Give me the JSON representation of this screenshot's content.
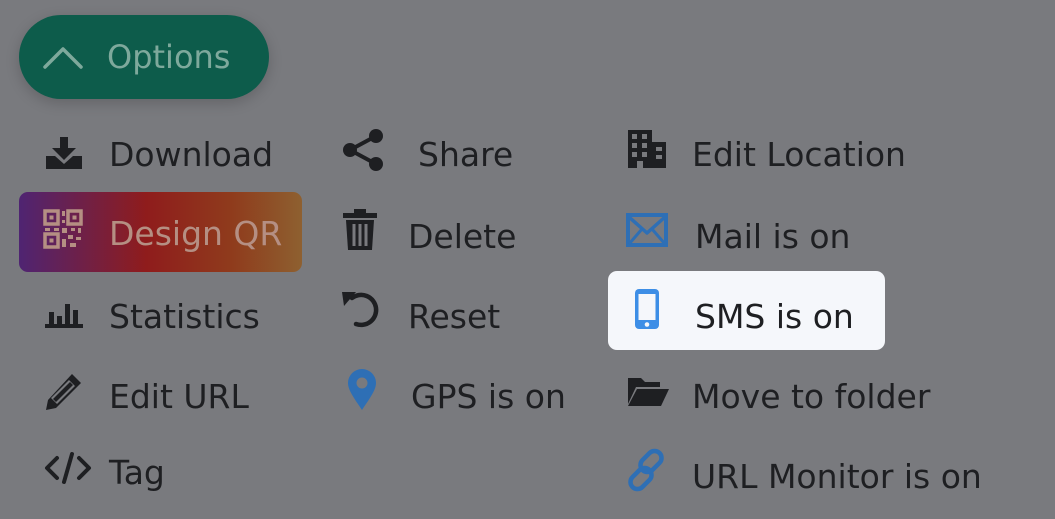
{
  "options_button": {
    "label": "Options",
    "icon": "chevron-up-icon"
  },
  "menu": {
    "column1": [
      {
        "label": "Download",
        "icon": "download-tray-icon"
      },
      {
        "label": "Design QR",
        "icon": "qr-code-icon"
      },
      {
        "label": "Statistics",
        "icon": "bar-chart-icon"
      },
      {
        "label": "Edit URL",
        "icon": "pencil-icon"
      },
      {
        "label": "Tag",
        "icon": "code-icon"
      }
    ],
    "column2": [
      {
        "label": "Share",
        "icon": "share-icon"
      },
      {
        "label": "Delete",
        "icon": "trash-icon"
      },
      {
        "label": "Reset",
        "icon": "undo-icon"
      },
      {
        "label": "GPS is on",
        "icon": "map-pin-icon"
      }
    ],
    "column3": [
      {
        "label": "Edit Location",
        "icon": "building-icon"
      },
      {
        "label": "Mail is on",
        "icon": "envelope-icon"
      },
      {
        "label": "SMS is on",
        "icon": "mobile-phone-icon"
      },
      {
        "label": "Move to folder",
        "icon": "folder-open-icon"
      },
      {
        "label": "URL Monitor is on",
        "icon": "link-icon"
      }
    ]
  },
  "colors": {
    "background": "#797a7e",
    "options_button": "#0d5c4b",
    "options_text": "#7ea99c",
    "active_blue": "#2e6fb5",
    "sms_blue": "#3d8ee6",
    "design_qr_start": "#4f2472",
    "design_qr_end": "#8e6030",
    "highlight_background": "#f5f7fb"
  }
}
